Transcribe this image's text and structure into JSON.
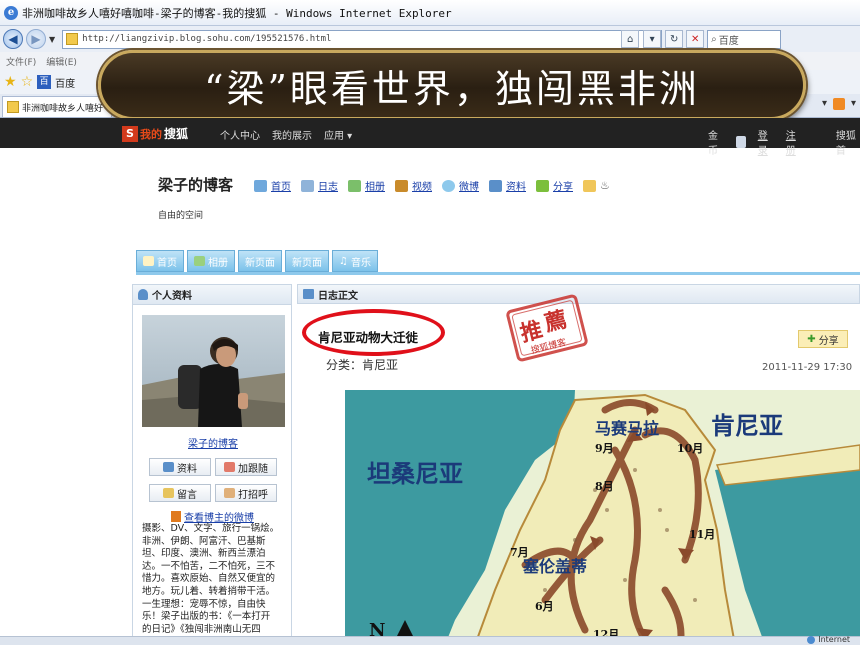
{
  "browser": {
    "window_title": "非洲咖啡故乡人嘻好嘻咖啡-梁子的博客-我的搜狐 - Windows Internet Explorer",
    "url": "http://liangzivip.blog.sohu.com/195521576.html",
    "search_placeholder": "百度",
    "menu": [
      "文件(F)",
      "编辑(E)"
    ],
    "favorites_item": "百度",
    "tab_title": "非洲咖啡故乡人嘻好"
  },
  "slide": {
    "title": "“梁”眼看世界，独闯黑非洲"
  },
  "sohu_nav": {
    "logo_my": "我的",
    "logo_name": "搜狐",
    "items": [
      "个人中心",
      "我的展示",
      "应用 ▾"
    ],
    "right": [
      "金币",
      "登录",
      "注册",
      "搜狐首"
    ]
  },
  "blog": {
    "name": "梁子的博客",
    "nav": [
      "首页",
      "日志",
      "相册",
      "视频",
      "微博",
      "资料",
      "分享"
    ],
    "tagline": "自由的空间",
    "tabs": [
      "首页",
      "相册",
      "新页面",
      "新页面",
      "音乐"
    ]
  },
  "sidebar": {
    "header": "个人资料",
    "blog_link": "梁子的博客",
    "buttons": [
      "资料",
      "加跟随",
      "留言",
      "打招呼"
    ],
    "weibo_link": "查看博主的微博",
    "bio_lines": [
      "摄影、DV、文字、旅行一锅烩。",
      "非洲、伊朗、阿富汗、巴基斯",
      "坦、印度、澳洲、新西兰漂泊",
      "达。一不怕苦，二不怕死，三不",
      "惜力。喜欢原始、自然又便宜的",
      "地方。玩儿着、转着捎带干活。",
      "一生理想：宠辱不惊，自由快",
      "乐！梁子出版的书：《一本打开",
      "的日记》《独闯非洲南山无四"
    ]
  },
  "article": {
    "section_header": "日志正文",
    "title": "肯尼亚动物大迁徙",
    "category": "分类：肯尼亚",
    "share": "分享",
    "datetime": "2011-11-29 17:30",
    "stamp_text": [
      "推",
      "薦"
    ],
    "stamp_sub": "搜狐博客",
    "map": {
      "labels": [
        "马赛马拉",
        "肯尼亚",
        "坦桑尼亚",
        "塞伦盖蒂"
      ],
      "months": [
        "9月",
        "10月",
        "8月",
        "11月",
        "7月",
        "6月",
        "12月"
      ],
      "north": "N"
    }
  },
  "status": {
    "zone": "Internet"
  },
  "colors": {
    "oval": "#e0101a",
    "banner_border": "#c9a95e",
    "sohu_bar": "#222222",
    "tab_blue": "#7cc2ea"
  }
}
